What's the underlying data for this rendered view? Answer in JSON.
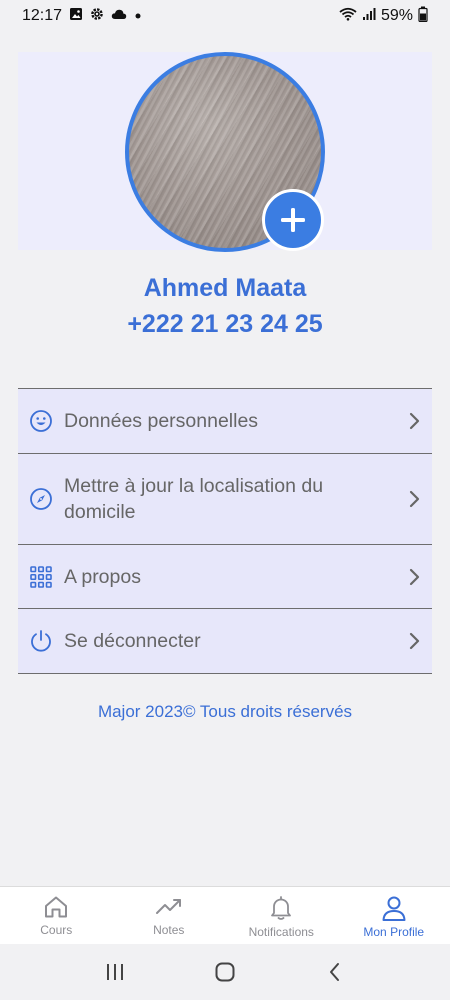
{
  "status_bar": {
    "time": "12:17",
    "battery": "59%"
  },
  "profile": {
    "name": "Ahmed Maata",
    "phone": "+222 21 23 24 25",
    "add_photo_icon": "plus-icon"
  },
  "menu": {
    "items": [
      {
        "label": "Données personnelles",
        "icon": "smile-icon"
      },
      {
        "label": "Mettre à jour la localisation du domicile",
        "icon": "compass-icon"
      },
      {
        "label": "A propos",
        "icon": "grid-icon"
      },
      {
        "label": "Se déconnecter",
        "icon": "power-icon"
      }
    ]
  },
  "footer": {
    "copyright": "Major 2023© Tous droits réservés"
  },
  "bottom_nav": {
    "items": [
      {
        "label": "Cours",
        "icon": "home-icon",
        "active": false
      },
      {
        "label": "Notes",
        "icon": "trending-icon",
        "active": false
      },
      {
        "label": "Notifications",
        "icon": "bell-icon",
        "active": false
      },
      {
        "label": "Mon Profile",
        "icon": "user-icon",
        "active": true
      }
    ]
  },
  "colors": {
    "accent": "#3b6fd6",
    "menu_bg": "#e7e7fa",
    "header_bg": "#ededfc",
    "page_bg": "#f1f1f3"
  }
}
